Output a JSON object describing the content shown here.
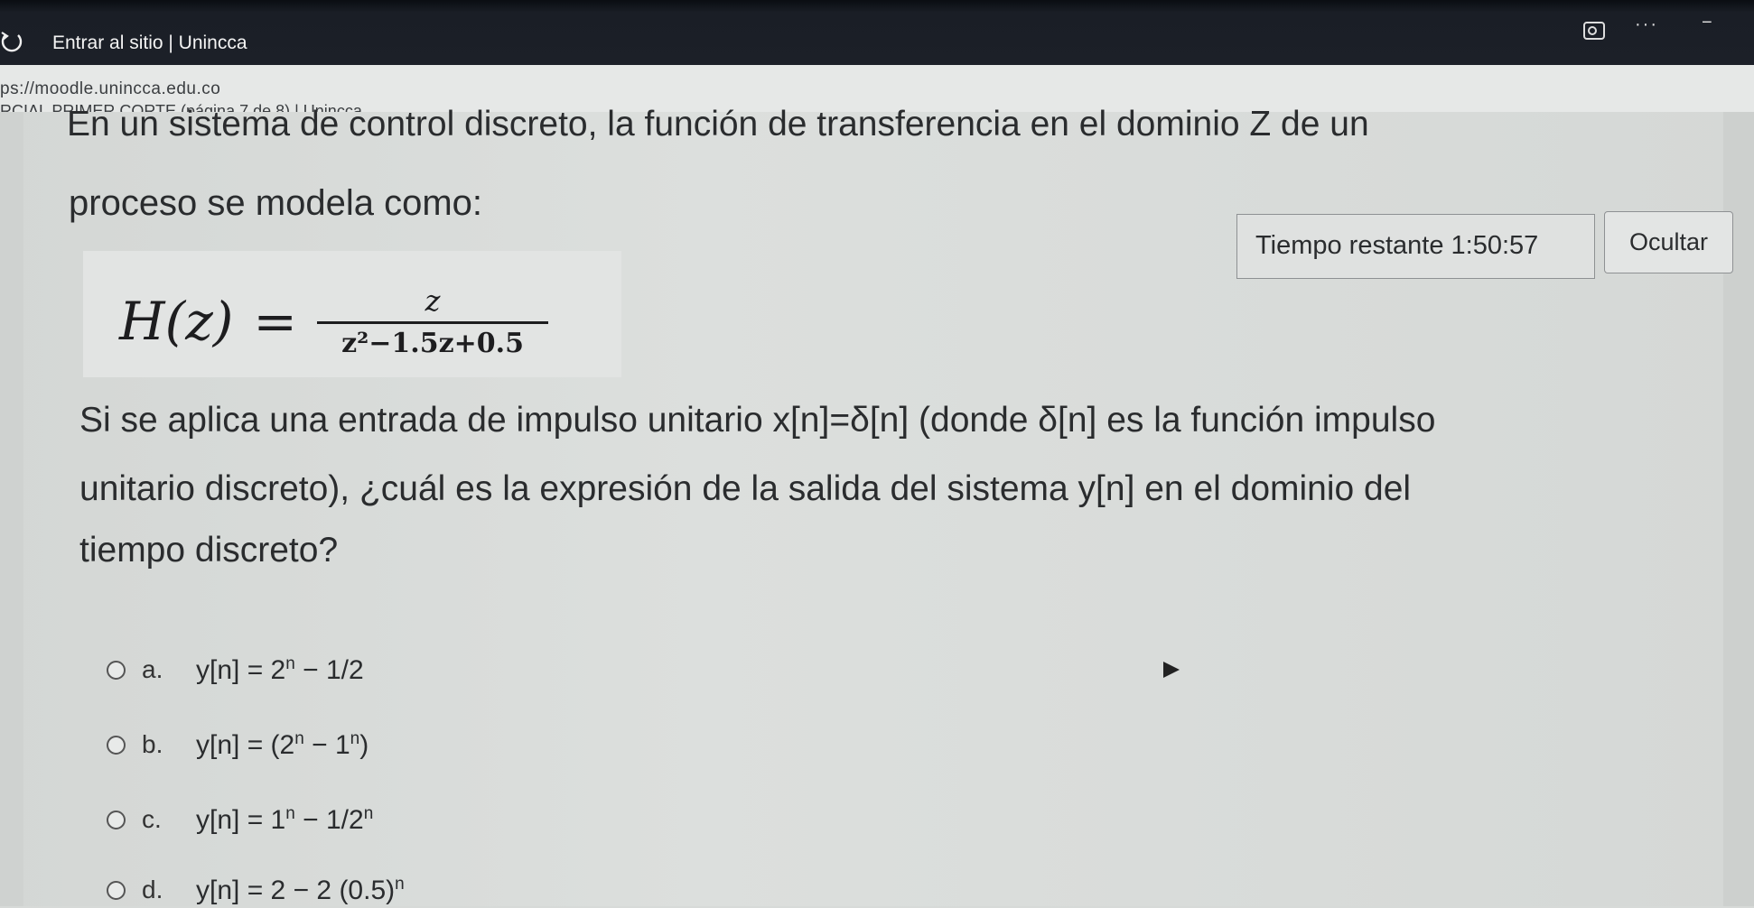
{
  "window": {
    "title": "Entrar al sitio | Unincca",
    "url": "ps://moodle.unincca.edu.co",
    "page_title": "RCIAL PRIMER CORTE (página 7 de 8) | Unincca"
  },
  "question": {
    "line1": "En un sistema de control discreto, la función de transferencia en el dominio Z de un",
    "line2": "proceso se modela como:",
    "formula_lhs": "H(z)",
    "formula_eq": "=",
    "formula_num": "z",
    "formula_den": "z²−1.5z+0.5",
    "para_line1": "Si se aplica una entrada de impulso unitario x[n]=δ[n] (donde δ[n] es la función impulso",
    "para_line2": "unitario discreto), ¿cuál es la expresión de la salida del sistema y[n] en el dominio del",
    "para_line3": "tiempo discreto?"
  },
  "timer": {
    "label": "Tiempo restante 1:50:57"
  },
  "hide_button": {
    "label": "Ocultar"
  },
  "options": [
    {
      "letter": "a.",
      "text": "y[n] = 2",
      "sup": "n",
      "rest": " − 1/2"
    },
    {
      "letter": "b.",
      "text": "y[n] = (2",
      "sup": "n",
      "rest": " − 1",
      "sup2": "n",
      "tail": ")"
    },
    {
      "letter": "c.",
      "text": "y[n] = 1",
      "sup": "n",
      "rest": " − 1/2",
      "sup2": "n"
    },
    {
      "letter": "d.",
      "text": "y[n] = 2 − 2 (0.5)",
      "sup": "n"
    }
  ],
  "icons": {
    "reload": "reload-icon",
    "search_tab": "search-icon",
    "more": "more-icon",
    "minimize": "minimize-icon"
  }
}
